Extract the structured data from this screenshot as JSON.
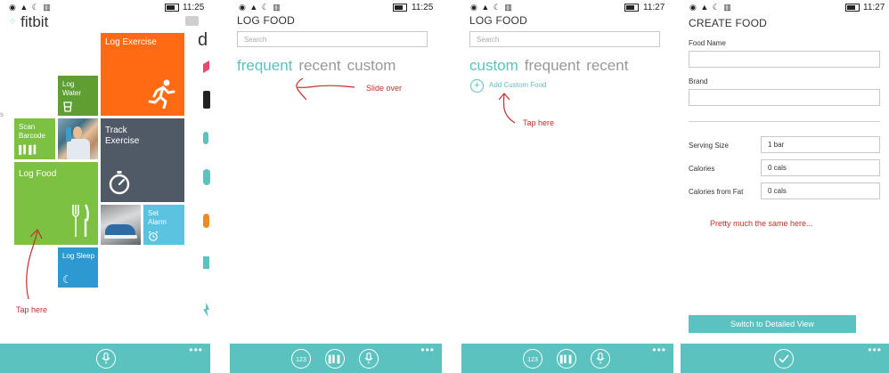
{
  "screen1": {
    "logo": "fitbit",
    "time": "11:25",
    "peek_letter": "d",
    "tiles": {
      "log_exercise": "Log Exercise",
      "log_water": "Log Water",
      "scan_barcode": "Scan Barcode",
      "track_exercise": "Track Exercise",
      "log_food": "Log Food",
      "set_alarm": "Set Alarm",
      "log_sleep": "Log Sleep"
    },
    "annotation": "Tap here"
  },
  "screen2": {
    "time": "11:25",
    "title": "LOG FOOD",
    "search_placeholder": "Search",
    "pivots": [
      "frequent",
      "recent",
      "custom"
    ],
    "annotation": "Slide over",
    "appbar_keypad": "123"
  },
  "screen3": {
    "time": "11:27",
    "title": "LOG FOOD",
    "search_placeholder": "Search",
    "pivots": [
      "custom",
      "frequent",
      "recent"
    ],
    "add_custom_food": "Add Custom Food",
    "annotation": "Tap here",
    "appbar_keypad": "123"
  },
  "screen4": {
    "time": "11:27",
    "title": "CREATE FOOD",
    "food_name_label": "Food Name",
    "brand_label": "Brand",
    "serving_size_label": "Serving Size",
    "serving_size_value": "1 bar",
    "calories_label": "Calories",
    "calories_value": "0 cals",
    "calories_fat_label": "Calories from Fat",
    "calories_fat_value": "0 cals",
    "annotation": "Pretty much the same here...",
    "detailed_view_button": "Switch to Detailed View"
  },
  "colors": {
    "teal": "#5bc2c0",
    "orange": "#ff6a13",
    "slate": "#4f5a66",
    "green": "#7dc142",
    "dark_green": "#5e9e32",
    "sky": "#5bc2e0",
    "blue": "#2c9ad0",
    "annotation_red": "#c0312b"
  }
}
